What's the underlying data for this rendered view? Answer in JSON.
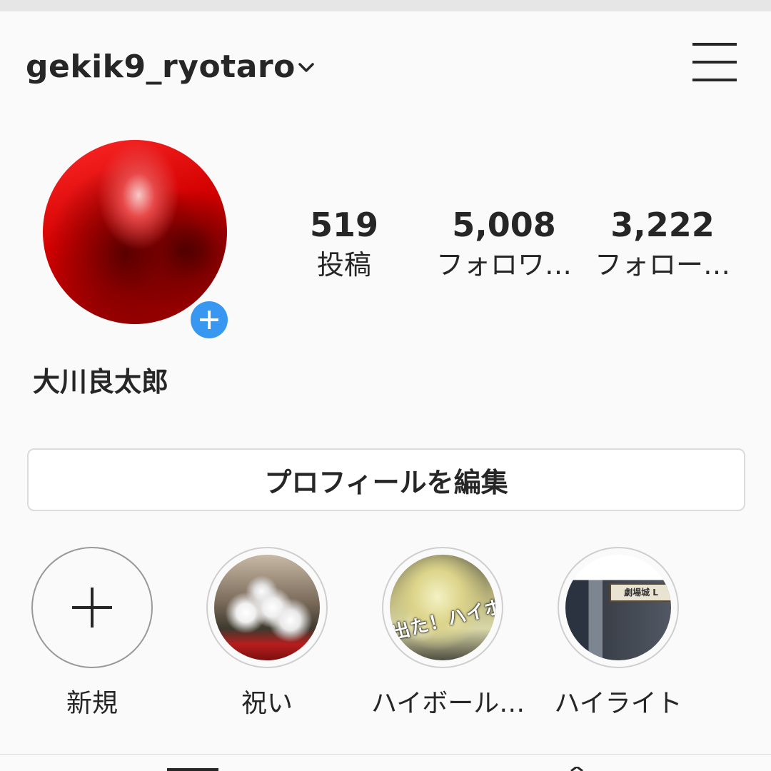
{
  "header": {
    "username": "gekik9_ryotaro",
    "dropdown_icon": "chevron-down-icon",
    "menu_icon": "hamburger-menu-icon"
  },
  "profile": {
    "display_name": "大川良太郎",
    "add_story_icon": "plus-icon"
  },
  "stats": [
    {
      "value": "519",
      "label": "投稿"
    },
    {
      "value": "5,008",
      "label": "フォロワ…"
    },
    {
      "value": "3,222",
      "label": "フォロー…"
    }
  ],
  "edit_profile_label": "プロフィールを編集",
  "highlights": [
    {
      "label": "新規",
      "icon": "plus-icon"
    },
    {
      "label": "祝い"
    },
    {
      "label": "ハイボール…",
      "overlay_text": "出た！ハイボール"
    },
    {
      "label": "ハイライト",
      "sign_text": "劇場城 L"
    }
  ],
  "colors": {
    "accent_blue": "#3897f0",
    "text": "#262626",
    "border": "#dbdbdb",
    "background": "#fafafa"
  }
}
